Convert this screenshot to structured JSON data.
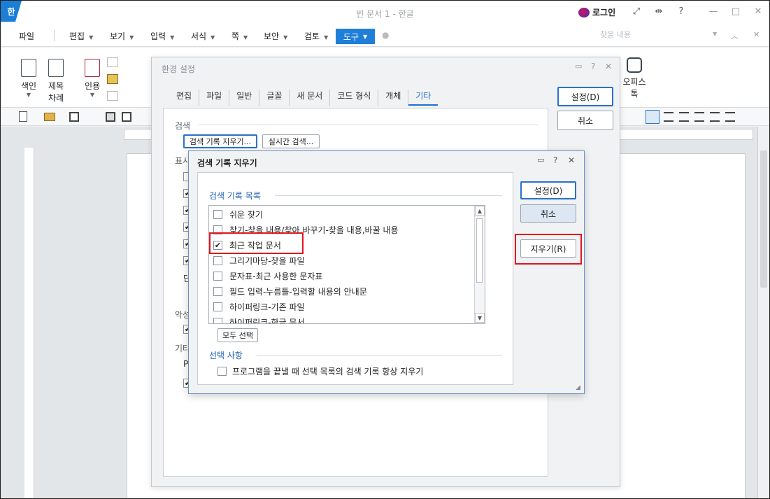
{
  "app": {
    "icon_label": "한",
    "title": "빈 문서 1 - 한글",
    "login_label": "로그인",
    "controls": [
      "⤢",
      "⇹",
      "?",
      "—",
      "□",
      "✕"
    ]
  },
  "menubar": {
    "file": "파일",
    "items": [
      "편집",
      "보기",
      "입력",
      "서식",
      "쪽",
      "보안",
      "검토"
    ],
    "tools": "도구",
    "find_placeholder": "찾을 내용"
  },
  "ribbon": {
    "index": "색인",
    "toc_line1": "제목",
    "toc_line2": "차례",
    "citation": "인용",
    "office_line1": "오피스",
    "office_line2": "톡"
  },
  "env_dialog": {
    "title": "환경 설정",
    "tabs": [
      "편집",
      "파일",
      "일반",
      "글꼴",
      "새 문서",
      "코드 형식",
      "개체",
      "기타"
    ],
    "active_tab": "기타",
    "ok_label": "설정(D)",
    "cancel_label": "취소",
    "search_section": "검색",
    "clear_history_button": "검색 기록 지우기...",
    "realtime_search_button": "실시간 검색...",
    "partial_labels": [
      "표시",
      "단",
      "악성",
      "기타",
      "P"
    ]
  },
  "clear_dialog": {
    "title": "검색 기록 지우기",
    "list_section": "검색 기록 목록",
    "items": [
      {
        "label": "쉬운 찾기",
        "checked": false
      },
      {
        "label": "찾기-찾을 내용/찾아 바꾸기-찾을 내용,바꿀 내용",
        "checked": false
      },
      {
        "label": "최근 작업 문서",
        "checked": true
      },
      {
        "label": "그리기마당-찾을 파일",
        "checked": false
      },
      {
        "label": "문자표-최근 사용한 문자표",
        "checked": false
      },
      {
        "label": "필드 입력-누름틀-입력할 내용의 안내문",
        "checked": false
      },
      {
        "label": "하이퍼링크-기존 파일",
        "checked": false
      },
      {
        "label": "하이퍼링크-한글 문서",
        "checked": false
      }
    ],
    "select_all": "모두 선택",
    "options_section": "선택 사항",
    "option_always_clear": "프로그램을 끝낼 때 선택 목록의 검색 기록 항상 지우기",
    "ok_label": "설정(D)",
    "cancel_label": "취소",
    "clear_label": "지우기(R)"
  }
}
